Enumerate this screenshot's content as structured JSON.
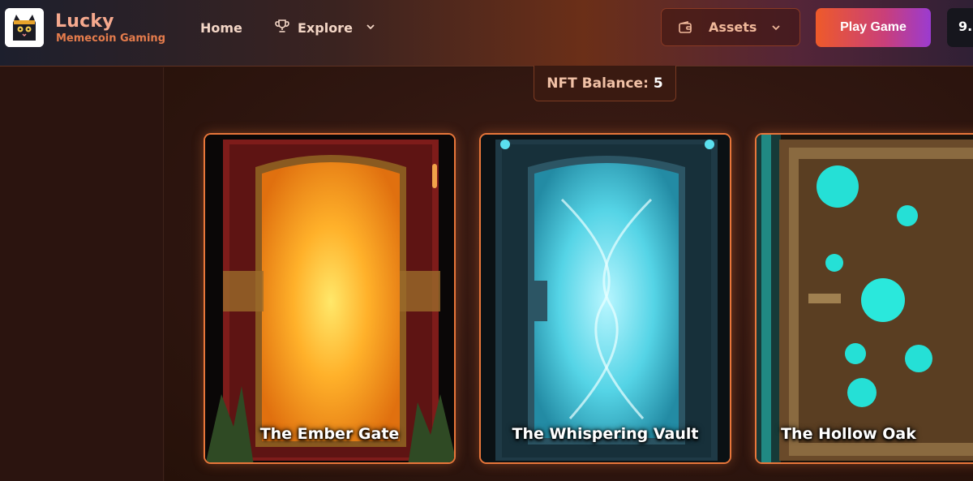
{
  "brand": {
    "title": "Lucky",
    "subtitle": "Memecoin Gaming",
    "logo_icon": "cat-icon"
  },
  "nav": {
    "home_label": "Home",
    "explore_label": "Explore",
    "explore_icon": "trophy-icon"
  },
  "header_actions": {
    "assets_label": "Assets",
    "assets_icon": "wallet-icon",
    "play_label": "Play Game",
    "balance_partial": "9."
  },
  "nft_balance": {
    "label": "NFT Balance:",
    "value": "5"
  },
  "cards": [
    {
      "title": "The Ember Gate",
      "theme_color": "#f7a21d"
    },
    {
      "title": "The Whispering Vault",
      "theme_color": "#3fd0e0"
    },
    {
      "title": "The Hollow Oak",
      "theme_color": "#1fd8d0"
    }
  ],
  "colors": {
    "accent": "#e8763a",
    "play_gradient_start": "#ee5a2a",
    "play_gradient_end": "#9b3bd0"
  }
}
